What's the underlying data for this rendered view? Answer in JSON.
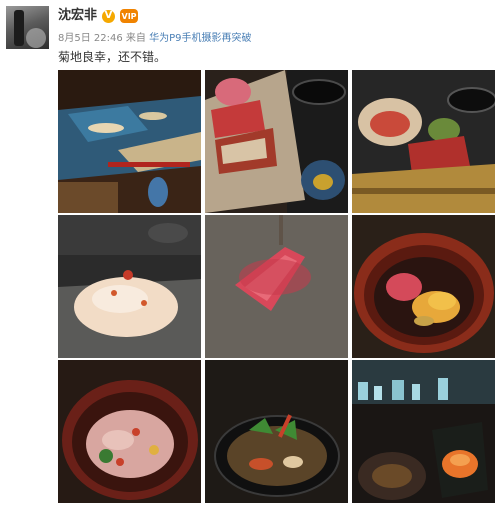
{
  "post": {
    "username": "沈宏非",
    "verified_symbol": "V",
    "vip_badge": "VIP",
    "date": "8月5日 22:46",
    "source_prefix": "来自",
    "source": "华为P9手机摄影再突破",
    "text": "菊地良幸，还不错。"
  },
  "colors": {
    "link": "#4a7fb5",
    "verified": "#f5a800",
    "vip": "#f08300"
  }
}
